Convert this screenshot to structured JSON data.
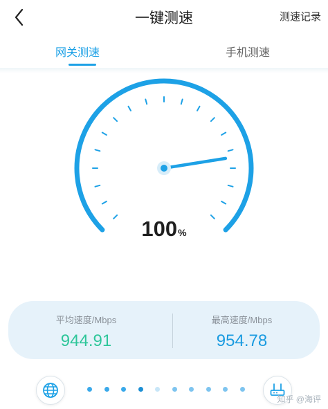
{
  "header": {
    "title": "一键测速",
    "history_label": "测速记录"
  },
  "tabs": [
    {
      "label": "网关测速",
      "active": true
    },
    {
      "label": "手机测速",
      "active": false
    }
  ],
  "gauge": {
    "value": "100",
    "unit": "%",
    "level": 1.0
  },
  "stats": {
    "avg": {
      "label": "平均速度/Mbps",
      "value": "944.91"
    },
    "max": {
      "label": "最高速度/Mbps",
      "value": "954.78"
    }
  },
  "colors": {
    "accent": "#1da1e6",
    "avg": "#2ec69a",
    "max": "#1a9be0"
  },
  "icons": {
    "back": "chevron-left-icon",
    "internet": "globe-icon",
    "router": "router-icon"
  },
  "progress_dots": {
    "count": 10,
    "active_index": 3
  },
  "watermark": "知乎 @海评"
}
